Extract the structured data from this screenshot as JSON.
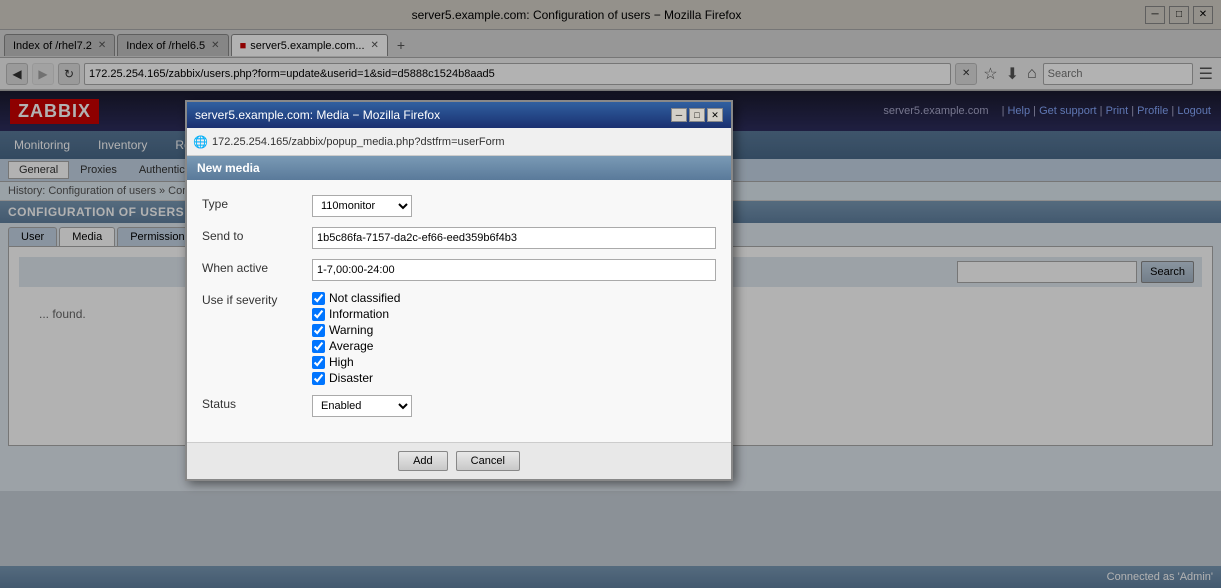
{
  "browser": {
    "title": "server5.example.com: Configuration of users − Mozilla Firefox",
    "tabs": [
      {
        "label": "Index of /rhel7.2",
        "active": false
      },
      {
        "label": "Index of /rhel6.5",
        "active": false
      },
      {
        "label": "server5.example.com...",
        "active": true
      }
    ],
    "address": "172.25.254.165/zabbix/users.php?form=update&userid=1&sid=d5888c1524b8aad5",
    "search_placeholder": "Search"
  },
  "modal": {
    "title": "server5.example.com: Media − Mozilla Firefox",
    "address": "172.25.254.165/zabbix/popup_media.php?dstfrm=userForm",
    "header": "New media",
    "fields": {
      "type_label": "Type",
      "type_value": "110monitor",
      "send_to_label": "Send to",
      "send_to_value": "1b5c86fa-7157-da2c-ef66-eed359b6f4b3",
      "when_active_label": "When active",
      "when_active_value": "1-7,00:00-24:00",
      "use_if_severity_label": "Use if severity",
      "severities": [
        {
          "label": "Not classified",
          "checked": true
        },
        {
          "label": "Information",
          "checked": true
        },
        {
          "label": "Warning",
          "checked": true
        },
        {
          "label": "Average",
          "checked": true
        },
        {
          "label": "High",
          "checked": true
        },
        {
          "label": "Disaster",
          "checked": true
        }
      ],
      "status_label": "Status",
      "status_value": "Enabled"
    },
    "buttons": {
      "add": "Add",
      "cancel": "Cancel"
    }
  },
  "zabbix": {
    "logo": "ZABBIX",
    "nav_links": [
      "Help",
      "Get support",
      "Print",
      "Profile",
      "Logout"
    ],
    "menu": [
      "Monitoring",
      "Inventory",
      "Reports"
    ],
    "sub_menu": [
      "General",
      "Proxies",
      "Authentication"
    ],
    "breadcrumb": "History: Configuration of users » Con...",
    "section_title": "CONFIGURATION OF USERS",
    "tabs": [
      "User",
      "Media",
      "Permissions"
    ],
    "search_button": "Search",
    "not_found": "... found.",
    "status_bar": "Connected as 'Admin'",
    "server": "server5.example.com"
  }
}
